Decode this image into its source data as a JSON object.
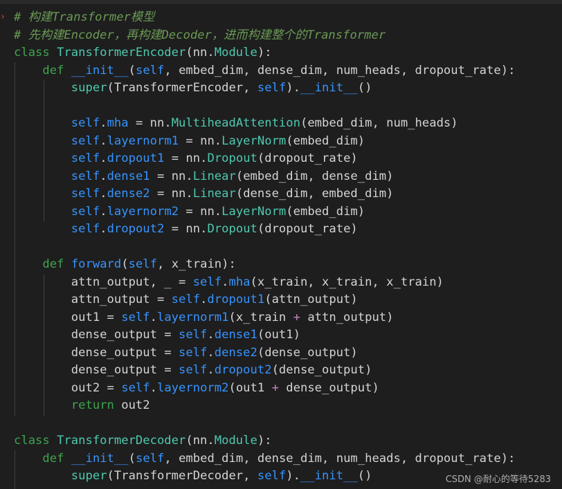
{
  "editor": {
    "lines": [
      [
        {
          "t": "# 构建Transformer模型",
          "c": "cmt"
        }
      ],
      [
        {
          "t": "# 先构建Encoder，再构建Decoder，进而构建整个的Transformer",
          "c": "cmt"
        }
      ],
      [
        {
          "t": "class ",
          "c": "kwd"
        },
        {
          "t": "TransformerEncoder",
          "c": "cls"
        },
        {
          "t": "(nn.",
          "c": "plain"
        },
        {
          "t": "Module",
          "c": "cls"
        },
        {
          "t": "):",
          "c": "plain"
        }
      ],
      [
        {
          "t": "    ",
          "c": "plain"
        },
        {
          "t": "def ",
          "c": "def"
        },
        {
          "t": "__init__",
          "c": "fn"
        },
        {
          "t": "(",
          "c": "plain"
        },
        {
          "t": "self",
          "c": "self"
        },
        {
          "t": ", embed_dim, dense_dim, num_heads, dropout_rate):",
          "c": "plain"
        }
      ],
      [
        {
          "t": "        ",
          "c": "plain"
        },
        {
          "t": "super",
          "c": "builtin"
        },
        {
          "t": "(TransformerEncoder, ",
          "c": "plain"
        },
        {
          "t": "self",
          "c": "self"
        },
        {
          "t": ").",
          "c": "plain"
        },
        {
          "t": "__init__",
          "c": "fn"
        },
        {
          "t": "()",
          "c": "plain"
        }
      ],
      [
        {
          "t": "",
          "c": "plain"
        }
      ],
      [
        {
          "t": "        ",
          "c": "plain"
        },
        {
          "t": "self",
          "c": "self"
        },
        {
          "t": ".",
          "c": "plain"
        },
        {
          "t": "mha",
          "c": "attr"
        },
        {
          "t": " = nn.",
          "c": "plain"
        },
        {
          "t": "MultiheadAttention",
          "c": "cls"
        },
        {
          "t": "(embed_dim, num_heads)",
          "c": "plain"
        }
      ],
      [
        {
          "t": "        ",
          "c": "plain"
        },
        {
          "t": "self",
          "c": "self"
        },
        {
          "t": ".",
          "c": "plain"
        },
        {
          "t": "layernorm1",
          "c": "attr"
        },
        {
          "t": " = nn.",
          "c": "plain"
        },
        {
          "t": "LayerNorm",
          "c": "cls"
        },
        {
          "t": "(embed_dim)",
          "c": "plain"
        }
      ],
      [
        {
          "t": "        ",
          "c": "plain"
        },
        {
          "t": "self",
          "c": "self"
        },
        {
          "t": ".",
          "c": "plain"
        },
        {
          "t": "dropout1",
          "c": "attr"
        },
        {
          "t": " = nn.",
          "c": "plain"
        },
        {
          "t": "Dropout",
          "c": "cls"
        },
        {
          "t": "(dropout_rate)",
          "c": "plain"
        }
      ],
      [
        {
          "t": "        ",
          "c": "plain"
        },
        {
          "t": "self",
          "c": "self"
        },
        {
          "t": ".",
          "c": "plain"
        },
        {
          "t": "dense1",
          "c": "attr"
        },
        {
          "t": " = nn.",
          "c": "plain"
        },
        {
          "t": "Linear",
          "c": "cls"
        },
        {
          "t": "(embed_dim, dense_dim)",
          "c": "plain"
        }
      ],
      [
        {
          "t": "        ",
          "c": "plain"
        },
        {
          "t": "self",
          "c": "self"
        },
        {
          "t": ".",
          "c": "plain"
        },
        {
          "t": "dense2",
          "c": "attr"
        },
        {
          "t": " = nn.",
          "c": "plain"
        },
        {
          "t": "Linear",
          "c": "cls"
        },
        {
          "t": "(dense_dim, embed_dim)",
          "c": "plain"
        }
      ],
      [
        {
          "t": "        ",
          "c": "plain"
        },
        {
          "t": "self",
          "c": "self"
        },
        {
          "t": ".",
          "c": "plain"
        },
        {
          "t": "layernorm2",
          "c": "attr"
        },
        {
          "t": " = nn.",
          "c": "plain"
        },
        {
          "t": "LayerNorm",
          "c": "cls"
        },
        {
          "t": "(embed_dim)",
          "c": "plain"
        }
      ],
      [
        {
          "t": "        ",
          "c": "plain"
        },
        {
          "t": "self",
          "c": "self"
        },
        {
          "t": ".",
          "c": "plain"
        },
        {
          "t": "dropout2",
          "c": "attr"
        },
        {
          "t": " = nn.",
          "c": "plain"
        },
        {
          "t": "Dropout",
          "c": "cls"
        },
        {
          "t": "(dropout_rate)",
          "c": "plain"
        }
      ],
      [
        {
          "t": "",
          "c": "plain"
        }
      ],
      [
        {
          "t": "    ",
          "c": "plain"
        },
        {
          "t": "def ",
          "c": "def"
        },
        {
          "t": "forward",
          "c": "fn"
        },
        {
          "t": "(",
          "c": "plain"
        },
        {
          "t": "self",
          "c": "self"
        },
        {
          "t": ", x_train):",
          "c": "plain"
        }
      ],
      [
        {
          "t": "        attn_output, _ = ",
          "c": "plain"
        },
        {
          "t": "self",
          "c": "self"
        },
        {
          "t": ".",
          "c": "plain"
        },
        {
          "t": "mha",
          "c": "attr"
        },
        {
          "t": "(x_train, x_train, x_train)",
          "c": "plain"
        }
      ],
      [
        {
          "t": "        attn_output = ",
          "c": "plain"
        },
        {
          "t": "self",
          "c": "self"
        },
        {
          "t": ".",
          "c": "plain"
        },
        {
          "t": "dropout1",
          "c": "attr"
        },
        {
          "t": "(attn_output)",
          "c": "plain"
        }
      ],
      [
        {
          "t": "        out1 = ",
          "c": "plain"
        },
        {
          "t": "self",
          "c": "self"
        },
        {
          "t": ".",
          "c": "plain"
        },
        {
          "t": "layernorm1",
          "c": "attr"
        },
        {
          "t": "(x_train ",
          "c": "plain"
        },
        {
          "t": "+",
          "c": "op"
        },
        {
          "t": " attn_output)",
          "c": "plain"
        }
      ],
      [
        {
          "t": "        dense_output = ",
          "c": "plain"
        },
        {
          "t": "self",
          "c": "self"
        },
        {
          "t": ".",
          "c": "plain"
        },
        {
          "t": "dense1",
          "c": "attr"
        },
        {
          "t": "(out1)",
          "c": "plain"
        }
      ],
      [
        {
          "t": "        dense_output = ",
          "c": "plain"
        },
        {
          "t": "self",
          "c": "self"
        },
        {
          "t": ".",
          "c": "plain"
        },
        {
          "t": "dense2",
          "c": "attr"
        },
        {
          "t": "(dense_output)",
          "c": "plain"
        }
      ],
      [
        {
          "t": "        dense_output = ",
          "c": "plain"
        },
        {
          "t": "self",
          "c": "self"
        },
        {
          "t": ".",
          "c": "plain"
        },
        {
          "t": "dropout2",
          "c": "attr"
        },
        {
          "t": "(dense_output)",
          "c": "plain"
        }
      ],
      [
        {
          "t": "        out2 = ",
          "c": "plain"
        },
        {
          "t": "self",
          "c": "self"
        },
        {
          "t": ".",
          "c": "plain"
        },
        {
          "t": "layernorm2",
          "c": "attr"
        },
        {
          "t": "(out1 ",
          "c": "plain"
        },
        {
          "t": "+",
          "c": "op"
        },
        {
          "t": " dense_output)",
          "c": "plain"
        }
      ],
      [
        {
          "t": "        ",
          "c": "plain"
        },
        {
          "t": "return",
          "c": "kwd"
        },
        {
          "t": " out2",
          "c": "plain"
        }
      ],
      [
        {
          "t": "",
          "c": "plain"
        }
      ],
      [
        {
          "t": "class ",
          "c": "kwd"
        },
        {
          "t": "TransformerDecoder",
          "c": "cls"
        },
        {
          "t": "(nn.",
          "c": "plain"
        },
        {
          "t": "Module",
          "c": "cls"
        },
        {
          "t": "):",
          "c": "plain"
        }
      ],
      [
        {
          "t": "    ",
          "c": "plain"
        },
        {
          "t": "def ",
          "c": "def"
        },
        {
          "t": "__init__",
          "c": "fn"
        },
        {
          "t": "(",
          "c": "plain"
        },
        {
          "t": "self",
          "c": "self"
        },
        {
          "t": ", embed_dim, dense_dim, num_heads, dropout_rate):",
          "c": "plain"
        }
      ],
      [
        {
          "t": "        ",
          "c": "plain"
        },
        {
          "t": "super",
          "c": "builtin"
        },
        {
          "t": "(TransformerDecoder, ",
          "c": "plain"
        },
        {
          "t": "self",
          "c": "self"
        },
        {
          "t": ").",
          "c": "plain"
        },
        {
          "t": "__init__",
          "c": "fn"
        },
        {
          "t": "()",
          "c": "plain"
        }
      ]
    ]
  },
  "watermark": {
    "text": "CSDN @耐心的等待5283"
  },
  "colors": {
    "background": "#1e1e1e",
    "comment": "#6a9955",
    "keyword": "#3fa44f",
    "class": "#4ec9b0",
    "function": "#3794ff",
    "operator": "#c586c0",
    "text": "#d4d4d4"
  }
}
